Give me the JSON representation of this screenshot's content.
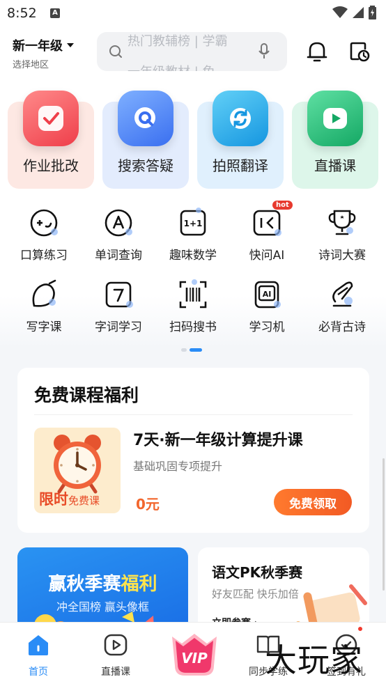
{
  "status_bar": {
    "time": "8:52",
    "app_icon_letter": "A"
  },
  "header": {
    "grade": "新一年级",
    "region": "选择地区",
    "search_hint_top": "热门教辅榜 | 学霸",
    "search_hint_bottom": "一年级教材 | 免"
  },
  "big_cards": [
    {
      "label": "作业批改",
      "bg": "#fde8e3",
      "icon": "check-icon",
      "icon_color": "#f0484b"
    },
    {
      "label": "搜索答疑",
      "bg": "#e3ecfd",
      "icon": "search-q-icon",
      "icon_color": "#3d7df3"
    },
    {
      "label": "拍照翻译",
      "bg": "#e0f0fd",
      "icon": "refresh-icon",
      "icon_color": "#1c9ee8"
    },
    {
      "label": "直播课",
      "bg": "#ddf6ea",
      "icon": "play-icon",
      "icon_color": "#19b56f"
    }
  ],
  "grid_row1": [
    {
      "label": "口算练习",
      "icon": "mental-math-icon"
    },
    {
      "label": "单词查询",
      "icon": "word-lookup-icon"
    },
    {
      "label": "趣味数学",
      "icon": "fun-math-icon"
    },
    {
      "label": "快问AI",
      "icon": "quick-ai-icon",
      "badge": "hot"
    },
    {
      "label": "诗词大赛",
      "icon": "trophy-icon"
    }
  ],
  "grid_row2": [
    {
      "label": "写字课",
      "icon": "writing-icon"
    },
    {
      "label": "字词学习",
      "icon": "character-icon"
    },
    {
      "label": "扫码搜书",
      "icon": "barcode-icon"
    },
    {
      "label": "学习机",
      "icon": "learning-device-icon"
    },
    {
      "label": "必背古诗",
      "icon": "poem-icon"
    }
  ],
  "free_course": {
    "title": "免费课程福利",
    "course_name": "7天·新一年级计算提升课",
    "course_desc": "基础巩固专项提升",
    "price": "0元",
    "button": "免费领取",
    "thumb_tag": "限时",
    "thumb_tag_small": "免费课"
  },
  "banner_left": {
    "title_a": "赢秋季赛",
    "title_b": "福利",
    "sub": "冲全国榜 赢头像框"
  },
  "banner_right": {
    "title": "语文PK秋季赛",
    "sub": "好友匹配 快乐加倍",
    "link": "立即参赛 ›"
  },
  "tabs": [
    {
      "label": "首页",
      "icon": "home-icon"
    },
    {
      "label": "直播课",
      "icon": "live-icon"
    },
    {
      "label": "VIP",
      "icon": "vip-icon"
    },
    {
      "label": "同步学练",
      "icon": "book-icon"
    },
    {
      "label": "签到有礼",
      "icon": "gift-icon"
    }
  ],
  "watermark": "大玩家",
  "colors": {
    "accent": "#2a8cf6",
    "price": "#f2662d",
    "hot": "#e73a2e"
  }
}
